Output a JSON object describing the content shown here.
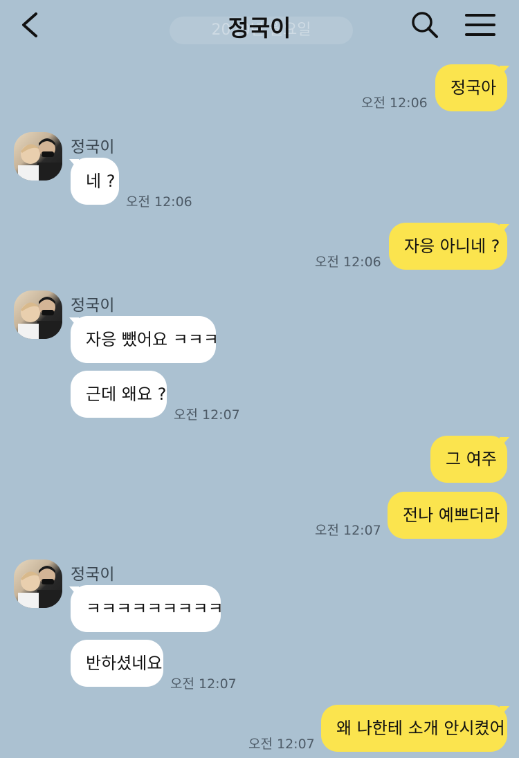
{
  "header": {
    "title": "정국이",
    "date_divider": "2020년 월요일",
    "icons": {
      "back": "chevron-left-icon",
      "search": "search-icon",
      "menu": "hamburger-menu-icon"
    }
  },
  "colors": {
    "background": "#abc1d1",
    "my_bubble": "#fbe44e",
    "their_bubble": "#ffffff"
  },
  "messages": [
    {
      "from": "me",
      "text": "정국아",
      "time": "오전 12:06"
    },
    {
      "from": "them",
      "sender": "정국이",
      "text": "네 ?",
      "time": "오전 12:06"
    },
    {
      "from": "me",
      "text": "자응 아니네 ?",
      "time": "오전 12:06"
    },
    {
      "from": "them",
      "sender": "정국이",
      "text": "자응 뺐어요 ㅋㅋㅋ"
    },
    {
      "from": "them",
      "text": "근데 왜요 ?",
      "time": "오전 12:07"
    },
    {
      "from": "me",
      "text": "그 여주"
    },
    {
      "from": "me",
      "text": "전나 예쁘더라",
      "time": "오전 12:07"
    },
    {
      "from": "them",
      "sender": "정국이",
      "text": "ㅋㅋㅋㅋㅋㅋㅋㅋㅋ"
    },
    {
      "from": "them",
      "text": "반하셨네요",
      "time": "오전 12:07"
    },
    {
      "from": "me",
      "text": "왜 나한테 소개 안시켰어",
      "time": "오전 12:07"
    }
  ]
}
